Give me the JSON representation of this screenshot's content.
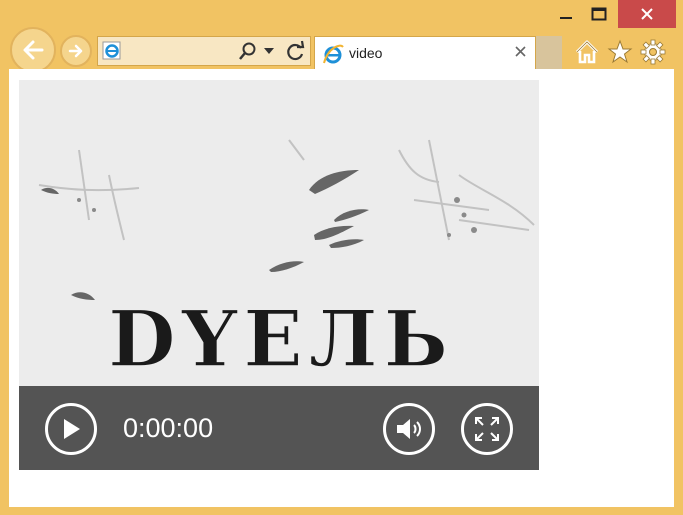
{
  "browser": {
    "tab": {
      "title": "video"
    },
    "address": {
      "value": ""
    },
    "icons": [
      "back-icon",
      "forward-icon",
      "ie-icon",
      "search-icon",
      "dropdown-icon",
      "refresh-icon",
      "close-tab-icon",
      "home-icon",
      "favorites-icon",
      "settings-icon",
      "minimize-icon",
      "maximize-icon",
      "close-icon"
    ]
  },
  "video": {
    "title_text": "DYEЛЬ",
    "current_time": "0:00:00",
    "controls": [
      "play-icon",
      "volume-icon",
      "fullscreen-icon"
    ]
  },
  "colors": {
    "frame": "#f1c363",
    "close_button": "#c94a4a",
    "controls_bar": "#545454",
    "video_bg": "#ececec"
  }
}
